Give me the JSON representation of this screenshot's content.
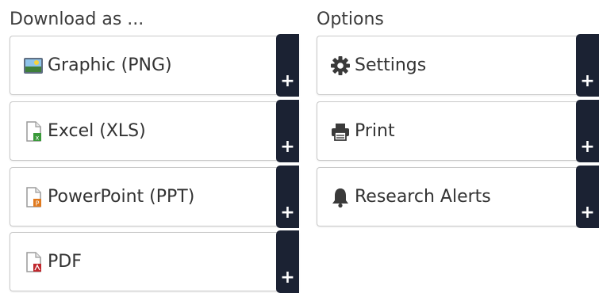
{
  "download": {
    "heading": "Download as ...",
    "items": [
      {
        "label": "Graphic (PNG)",
        "icon": "image-file-icon"
      },
      {
        "label": "Excel (XLS)",
        "icon": "excel-file-icon",
        "color": "#3a9a3a"
      },
      {
        "label": "PowerPoint (PPT)",
        "icon": "powerpoint-file-icon",
        "color": "#e07a1f"
      },
      {
        "label": "PDF",
        "icon": "pdf-file-icon",
        "color": "#c0282d"
      }
    ]
  },
  "options": {
    "heading": "Options",
    "items": [
      {
        "label": "Settings",
        "icon": "gear-icon"
      },
      {
        "label": "Print",
        "icon": "printer-icon"
      },
      {
        "label": "Research Alerts",
        "icon": "bell-icon"
      }
    ]
  },
  "plus_label": "+",
  "colors": {
    "plus_bg": "#1b2233",
    "border": "#c9c9c9",
    "text": "#333333"
  }
}
